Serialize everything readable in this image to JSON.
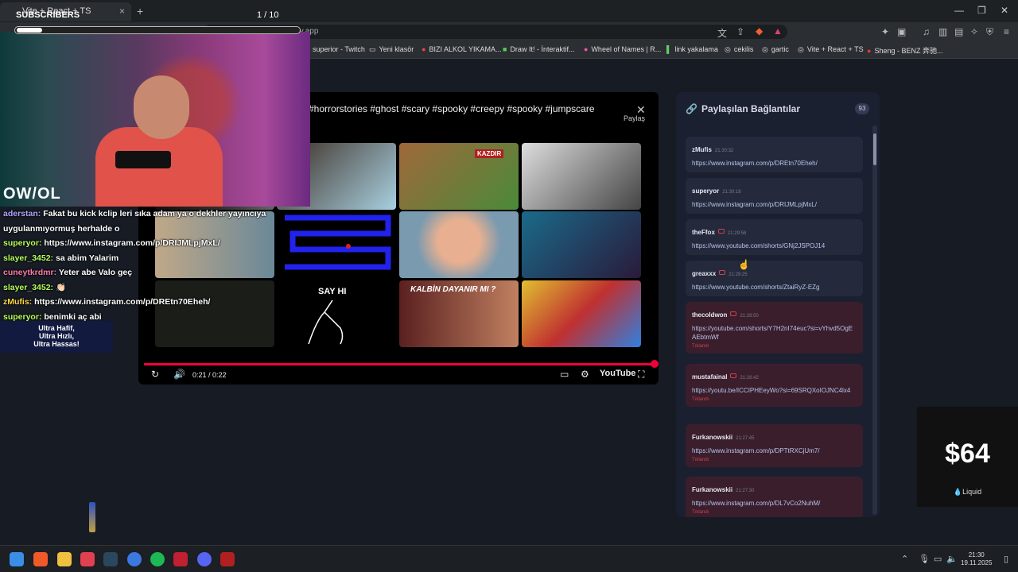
{
  "browser": {
    "tab_title": "Vite + React + TS",
    "url": "linkyakalama.netlify.app",
    "bookmarks": [
      "superior - Twitch",
      "Yeni klasör",
      "BIZI ALKOL YIKAMA...",
      "Draw It! - İnteraktif...",
      "Wheel of Names | R...",
      "link yakalama",
      "cekilis",
      "gartic",
      "Vite + React + TS",
      "Sheng - BENZ 奔驰..."
    ]
  },
  "overlay": {
    "subscribers_label": "SUBSCRIBERS",
    "subscribers_counter": "1  / 10",
    "subscribers_progress": 0.1,
    "cam_logo": "OW/OL",
    "ad_text": "Ultra Hafif,\nUltra Hızlı,\nUltra Hassas!"
  },
  "chat": [
    {
      "user": "aderstan:",
      "text": "Fakat bu kick kclip leri sıka adam ya o dekhler yayıncıya uygulanmıyormuş herhalde o",
      "color": "#b3a3ff"
    },
    {
      "user": "superyor:",
      "text": "https://www.instagram.com/p/DRIJMLpjMxL/",
      "color": "#b7ff5a"
    },
    {
      "user": "slayer_3452:",
      "text": "sa abim Yalarim",
      "color": "#b7ff5a"
    },
    {
      "user": "cuneytkrdmr:",
      "text": "Yeter abe Valo geç",
      "color": "#ff7aa8"
    },
    {
      "user": "slayer_3452:",
      "text": "👏🏻",
      "color": "#b7ff5a"
    },
    {
      "user": "zMufis:",
      "text": "https://www.instagram.com/p/DREtn70Eheh/",
      "color": "#ffd84a"
    },
    {
      "user": "superyor:",
      "text": "benimki aç abi",
      "color": "#b7ff5a"
    }
  ],
  "video": {
    "title": "#horrorstories #ghost #scary #spooky #creepy #spooky #jumpscare",
    "share_label": "Paylaş",
    "time": "0:21 / 0:22",
    "brand": "YouTube",
    "thumb_labels": [
      "KAZDIR",
      "SAY HI",
      "KALBİN DAYANIR MI ?"
    ],
    "progress": 0.95
  },
  "panel": {
    "title": "Paylaşılan Bağlantılar",
    "count": "93",
    "clicked_label": "Tıklandı",
    "links": [
      {
        "user": "zMufis",
        "time": "21:30:32",
        "url": "https://www.instagram.com/p/DREtn70Eheh/",
        "yt": false,
        "clicked": false
      },
      {
        "user": "superyor",
        "time": "21:30:18",
        "url": "https://www.instagram.com/p/DRIJMLpjMxL/",
        "yt": false,
        "clicked": false
      },
      {
        "user": "theFfox",
        "time": "21:29:58",
        "url": "https://www.youtube.com/shorts/GNj2JSPOJ14",
        "yt": true,
        "clicked": false
      },
      {
        "user": "greaxxx",
        "time": "21:29:25",
        "url": "https://www.youtube.com/shorts/ZtaiRyZ-EZg",
        "yt": true,
        "clicked": false
      },
      {
        "user": "thecoldwon",
        "time": "21:28:50",
        "url": "https://youtube.com/shorts/Y7H2nI74euc?si=vYhvd5OgEAEbtmWf",
        "yt": true,
        "clicked": true
      },
      {
        "user": "mustafainal",
        "time": "21:28:42",
        "url": "https://youtu.be/ICCIPHEeyWo?si=69SRQXoIOJNC4lx4",
        "yt": true,
        "clicked": true
      },
      {
        "user": "Furkanowskii",
        "time": "21:27:45",
        "url": "https://www.instagram.com/p/DPTtRXCjUm7/",
        "yt": false,
        "clicked": true
      },
      {
        "user": "Furkanowskii",
        "time": "21:27:30",
        "url": "https://www.instagram.com/p/DL7vCo2NuhM/",
        "yt": false,
        "clicked": true
      }
    ]
  },
  "donation": {
    "amount": "$64",
    "label": "Liquid"
  },
  "taskbar": {
    "time": "21:30",
    "date": "19.11.2025"
  }
}
